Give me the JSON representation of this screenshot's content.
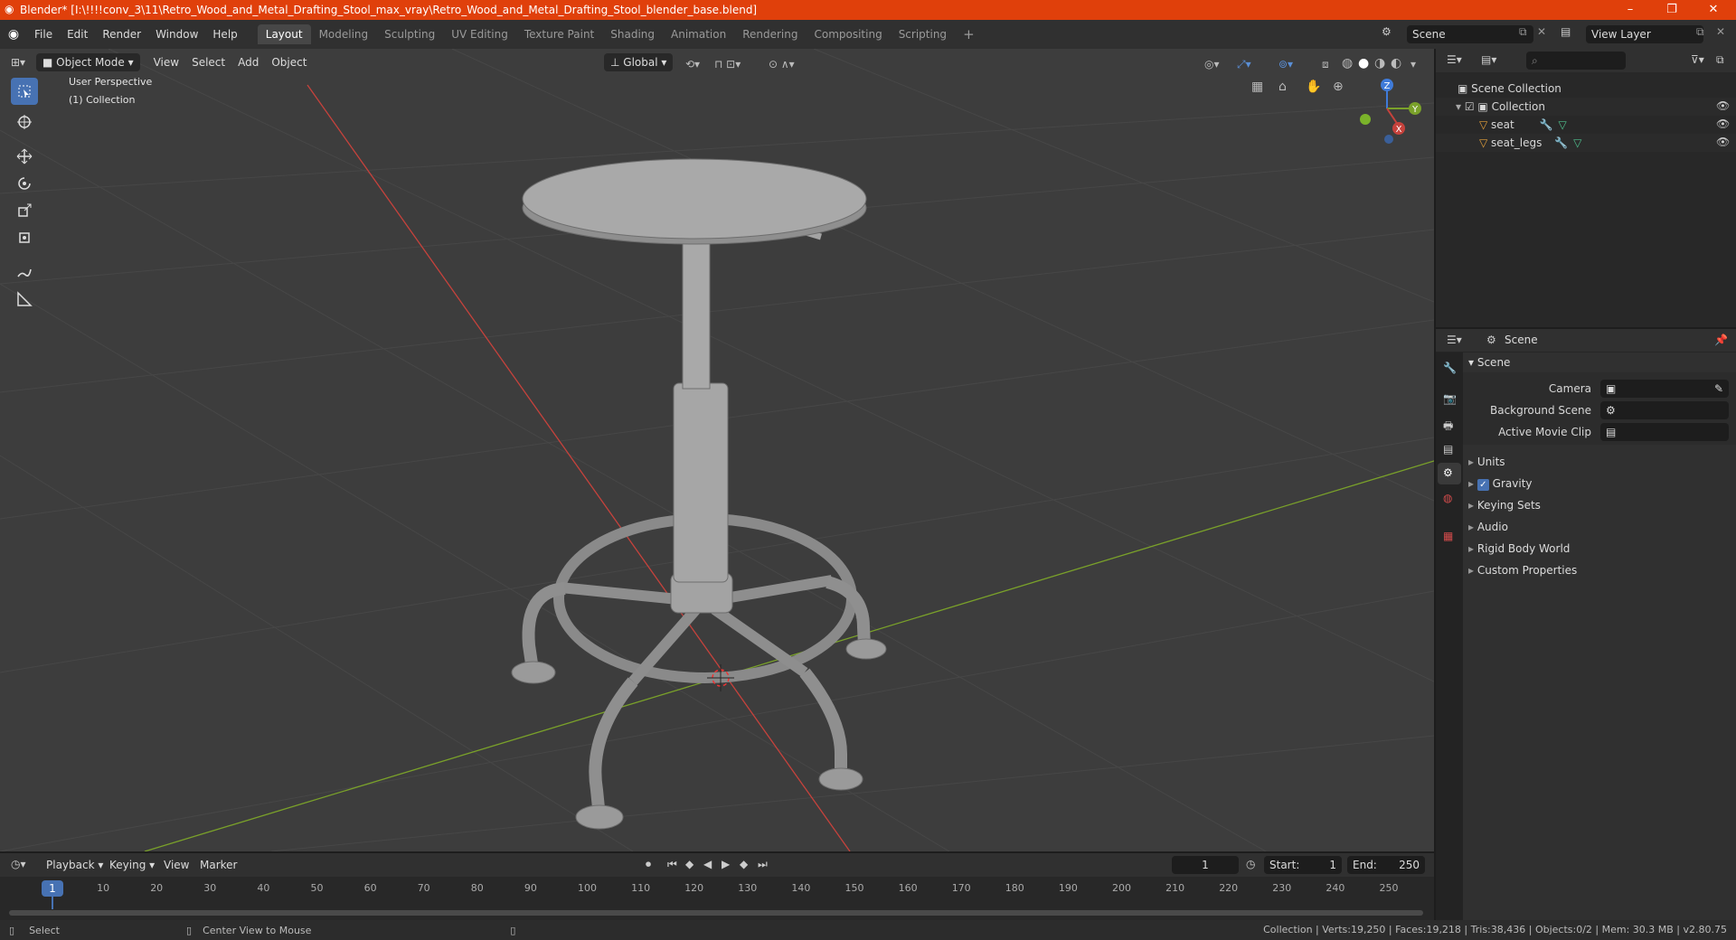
{
  "window": {
    "title": "Blender* [I:\\!!!!conv_3\\11\\Retro_Wood_and_Metal_Drafting_Stool_max_vray\\Retro_Wood_and_Metal_Drafting_Stool_blender_base.blend]",
    "minimize": "–",
    "maximize": "❐",
    "close": "✕"
  },
  "menus": [
    "File",
    "Edit",
    "Render",
    "Window",
    "Help"
  ],
  "workspaces": [
    "Layout",
    "Modeling",
    "Sculpting",
    "UV Editing",
    "Texture Paint",
    "Shading",
    "Animation",
    "Rendering",
    "Compositing",
    "Scripting"
  ],
  "scene_name": "Scene",
  "view_layer": "View Layer",
  "viewport_header": {
    "mode": "Object Mode",
    "menus": [
      "View",
      "Select",
      "Add",
      "Object"
    ],
    "transform": "Global"
  },
  "viewport": {
    "perspective": "User Perspective",
    "collection": "(1) Collection",
    "gizmo": {
      "x": "X",
      "y": "Y",
      "z": "Z"
    }
  },
  "outliner": {
    "root": "Scene Collection",
    "collection": "Collection",
    "objects": [
      "seat",
      "seat_legs"
    ]
  },
  "properties": {
    "header": "Scene",
    "section": "Scene",
    "fields": [
      {
        "label": "Camera",
        "value": ""
      },
      {
        "label": "Background Scene",
        "value": ""
      },
      {
        "label": "Active Movie Clip",
        "value": ""
      }
    ],
    "panels": [
      "Units",
      "Gravity",
      "Keying Sets",
      "Audio",
      "Rigid Body World",
      "Custom Properties"
    ],
    "gravity_checked": true
  },
  "timeline": {
    "menus": [
      "Playback",
      "Keying",
      "View",
      "Marker"
    ],
    "current_frame": "1",
    "start_label": "Start:",
    "start": "1",
    "end_label": "End:",
    "end": "250",
    "ruler": [
      "10",
      "20",
      "30",
      "40",
      "50",
      "60",
      "70",
      "80",
      "90",
      "100",
      "110",
      "120",
      "130",
      "140",
      "150",
      "160",
      "170",
      "180",
      "190",
      "200",
      "210",
      "220",
      "230",
      "240",
      "250"
    ]
  },
  "statusbar": {
    "left": "Select",
    "middle": "Center View to Mouse",
    "right": "Collection | Verts:19,250 | Faces:19,218 | Tris:38,436 | Objects:0/2 | Mem: 30.3 MB | v2.80.75"
  },
  "colors": {
    "titlebar": "#e0400b",
    "accent": "#4772b3",
    "x_axis": "#c6423c",
    "y_axis": "#7aa12a",
    "z_axis": "#3f7bd9"
  }
}
